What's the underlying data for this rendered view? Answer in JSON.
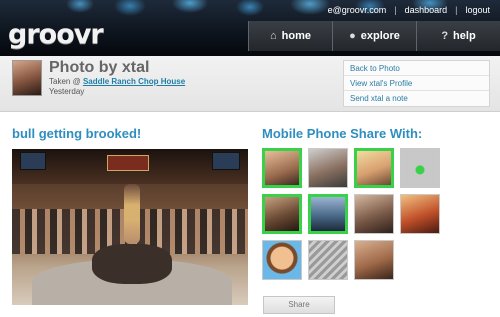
{
  "app": {
    "logo": "groovr"
  },
  "header": {
    "user_email": "e@groovr.com",
    "dashboard": "dashboard",
    "logout": "logout",
    "nav": [
      {
        "label": "home",
        "icon": "home-icon"
      },
      {
        "label": "explore",
        "icon": "globe-icon"
      },
      {
        "label": "help",
        "icon": "question-icon"
      }
    ]
  },
  "profile": {
    "title": "Photo by xtal",
    "taken_prefix": "Taken @",
    "place": "Saddle Ranch Chop House",
    "when": "Yesterday",
    "links": [
      "Back to Photo",
      "View xtal's Profile",
      "Send xtal a note"
    ]
  },
  "photo": {
    "caption": "bull getting brooked!"
  },
  "share": {
    "title": "Mobile Phone Share With:",
    "button_label": "Share",
    "contacts": [
      {
        "selected": true
      },
      {
        "selected": false
      },
      {
        "selected": true
      },
      {
        "selected": false
      },
      {
        "selected": true
      },
      {
        "selected": true
      },
      {
        "selected": false
      },
      {
        "selected": false
      },
      {
        "selected": false
      },
      {
        "selected": false
      },
      {
        "selected": false
      }
    ]
  },
  "colors": {
    "accent": "#2f8ec0",
    "selected_border": "#3ad14a",
    "link": "#2a7ca4"
  }
}
